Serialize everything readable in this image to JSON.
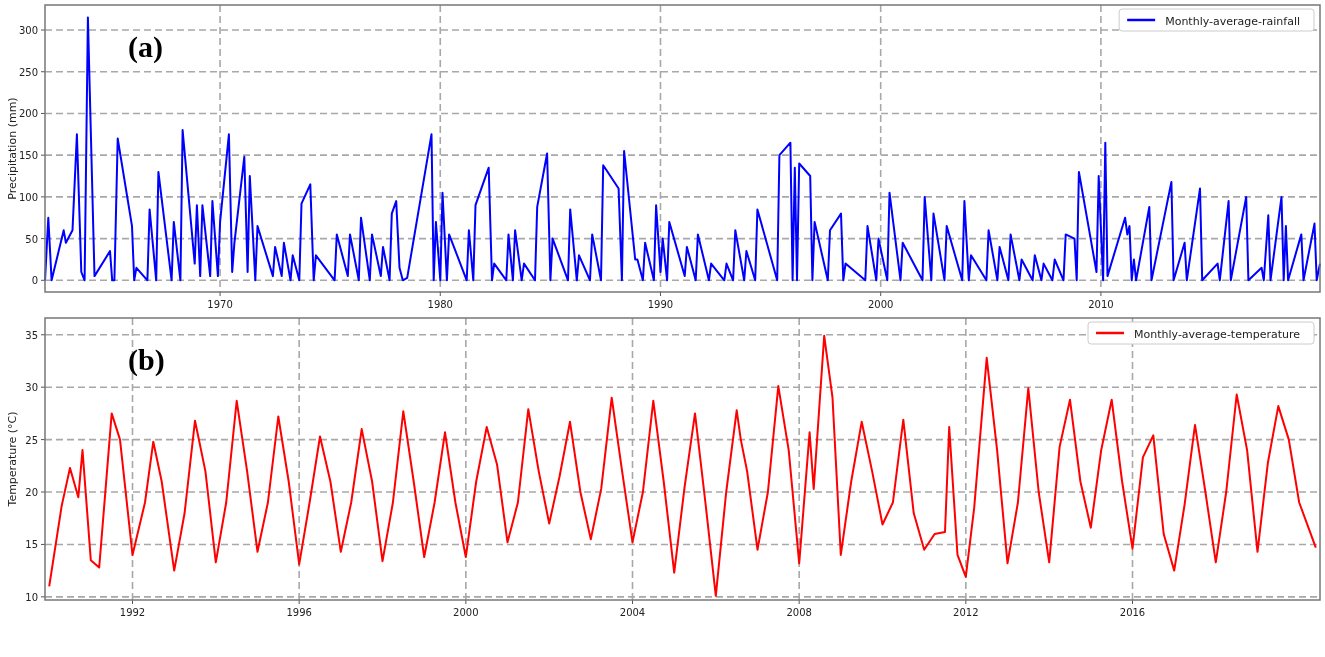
{
  "panels": [
    {
      "chart_data": {
        "type": "line",
        "ylabel": "Precipitation (mm)",
        "annotations": [
          "(a)"
        ],
        "grid": true,
        "xlim": [
          1962.05,
          2019.95
        ],
        "ylim": [
          -14,
          330
        ],
        "xticks": [
          {
            "value": 1970,
            "label": "1970"
          },
          {
            "value": 1980,
            "label": "1980"
          },
          {
            "value": 1990,
            "label": "1990"
          },
          {
            "value": 2000,
            "label": "2000"
          },
          {
            "value": 2010,
            "label": "2010"
          }
        ],
        "yticks": [
          {
            "value": 0,
            "label": "0"
          },
          {
            "value": 50,
            "label": "50"
          },
          {
            "value": 100,
            "label": "100"
          },
          {
            "value": 150,
            "label": "150"
          },
          {
            "value": 200,
            "label": "200"
          },
          {
            "value": 250,
            "label": "250"
          },
          {
            "value": 300,
            "label": "300"
          }
        ],
        "x": [
          1962.05,
          1962.2,
          1962.35,
          1962.9,
          1963.0,
          1963.3,
          1963.5,
          1963.7,
          1963.85,
          1964.0,
          1964.3,
          1965.0,
          1965.1,
          1965.2,
          1965.35,
          1966.0,
          1966.1,
          1966.2,
          1966.7,
          1966.8,
          1967.1,
          1967.2,
          1967.8,
          1967.9,
          1968.2,
          1968.3,
          1968.85,
          1968.95,
          1969.1,
          1969.2,
          1969.55,
          1969.65,
          1969.9,
          1970.0,
          1970.4,
          1970.55,
          1970.65,
          1971.1,
          1971.25,
          1971.35,
          1971.6,
          1971.7,
          1972.4,
          1972.5,
          1972.8,
          1972.9,
          1973.2,
          1973.3,
          1973.6,
          1973.7,
          1974.1,
          1974.25,
          1974.35,
          1975.2,
          1975.3,
          1975.8,
          1975.9,
          1976.3,
          1976.4,
          1976.8,
          1976.9,
          1977.3,
          1977.4,
          1977.7,
          1977.8,
          1978.0,
          1978.15,
          1978.3,
          1978.5,
          1979.6,
          1979.7,
          1979.8,
          1980.0,
          1980.1,
          1980.3,
          1980.4,
          1981.2,
          1981.3,
          1981.5,
          1981.6,
          1982.2,
          1982.35,
          1982.45,
          1983.0,
          1983.1,
          1983.3,
          1983.4,
          1983.7,
          1983.8,
          1984.3,
          1984.4,
          1984.85,
          1985.0,
          1985.1,
          1985.8,
          1985.9,
          1986.2,
          1986.3,
          1986.8,
          1986.9,
          1987.3,
          1987.4,
          1988.1,
          1988.25,
          1988.35,
          1988.85,
          1988.95,
          1989.2,
          1989.3,
          1989.7,
          1989.8,
          1990.0,
          1990.1,
          1990.3,
          1990.4,
          1991.1,
          1991.2,
          1991.6,
          1991.7,
          1992.2,
          1992.3,
          1992.9,
          1993.0,
          1993.3,
          1993.4,
          1993.8,
          1993.9,
          1994.3,
          1994.4,
          1995.3,
          1995.4,
          1995.9,
          1996.0,
          1996.1,
          1996.2,
          1996.3,
          1996.8,
          1996.9,
          1997.0,
          1997.6,
          1997.7,
          1998.2,
          1998.3,
          1998.4,
          1999.3,
          1999.4,
          1999.8,
          1999.9,
          2000.3,
          2000.4,
          2000.9,
          2001.0,
          2001.9,
          2002.0,
          2002.3,
          2002.4,
          2002.9,
          2003.0,
          2003.7,
          2003.8,
          2004.0,
          2004.1,
          2004.8,
          2004.9,
          2005.3,
          2005.4,
          2005.8,
          2005.9,
          2006.3,
          2006.4,
          2006.9,
          2007.0,
          2007.3,
          2007.4,
          2007.8,
          2007.9,
          2008.3,
          2008.4,
          2008.8,
          2008.9,
          2009.0,
          2009.8,
          2009.9,
          2010.1,
          2010.2,
          2010.3,
          2011.1,
          2011.2,
          2011.3,
          2011.4,
          2011.5,
          2011.6,
          2012.2,
          2012.3,
          2013.2,
          2013.3,
          2013.8,
          2013.9,
          2014.5,
          2014.6,
          2015.3,
          2015.4,
          2015.8,
          2015.9,
          2016.6,
          2016.7,
          2017.3,
          2017.4,
          2017.6,
          2017.7,
          2018.2,
          2018.3,
          2018.4,
          2018.5,
          2019.1,
          2019.2,
          2019.7,
          2019.8,
          2019.95
        ],
        "series": [
          {
            "name": "Monthly-average-rainfall",
            "color": "#0000ff",
            "values": [
              0,
              75,
              0,
              60,
              45,
              60,
              175,
              10,
              0,
              315,
              5,
              35,
              0,
              0,
              170,
              65,
              0,
              15,
              0,
              85,
              0,
              130,
              0,
              70,
              0,
              180,
              20,
              90,
              5,
              90,
              5,
              95,
              5,
              70,
              175,
              10,
              45,
              148,
              10,
              125,
              0,
              65,
              5,
              40,
              5,
              45,
              0,
              30,
              0,
              92,
              115,
              0,
              30,
              0,
              55,
              5,
              55,
              0,
              75,
              0,
              55,
              5,
              40,
              0,
              80,
              95,
              15,
              0,
              3,
              175,
              0,
              70,
              0,
              105,
              0,
              55,
              0,
              60,
              0,
              90,
              135,
              0,
              20,
              0,
              55,
              0,
              60,
              0,
              20,
              0,
              88,
              152,
              0,
              50,
              0,
              85,
              0,
              30,
              0,
              55,
              0,
              138,
              110,
              0,
              155,
              25,
              25,
              0,
              45,
              0,
              90,
              10,
              50,
              0,
              70,
              5,
              40,
              0,
              55,
              0,
              20,
              0,
              20,
              0,
              60,
              0,
              35,
              0,
              85,
              0,
              150,
              165,
              0,
              135,
              0,
              140,
              125,
              0,
              70,
              0,
              60,
              80,
              0,
              20,
              0,
              65,
              0,
              50,
              0,
              105,
              0,
              45,
              0,
              100,
              0,
              80,
              0,
              65,
              0,
              95,
              0,
              30,
              0,
              60,
              0,
              40,
              0,
              55,
              0,
              25,
              0,
              30,
              0,
              20,
              0,
              25,
              0,
              55,
              50,
              0,
              130,
              10,
              125,
              0,
              165,
              5,
              75,
              55,
              65,
              0,
              25,
              0,
              88,
              0,
              118,
              0,
              45,
              0,
              110,
              0,
              20,
              0,
              95,
              0,
              100,
              0,
              15,
              0,
              78,
              0,
              100,
              0,
              65,
              0,
              55,
              0,
              68,
              0,
              20
            ]
          }
        ]
      }
    },
    {
      "chart_data": {
        "type": "line",
        "ylabel": "Temperature (°C)",
        "annotations": [
          "(b)"
        ],
        "grid": true,
        "xlim": [
          1989.9,
          2020.5
        ],
        "ylim": [
          9.7,
          36.6
        ],
        "xticks": [
          {
            "value": 1992,
            "label": "1992"
          },
          {
            "value": 1996,
            "label": "1996"
          },
          {
            "value": 2000,
            "label": "2000"
          },
          {
            "value": 2004,
            "label": "2004"
          },
          {
            "value": 2008,
            "label": "2008"
          },
          {
            "value": 2012,
            "label": "2012"
          },
          {
            "value": 2016,
            "label": "2016"
          }
        ],
        "yticks": [
          {
            "value": 10,
            "label": "10"
          },
          {
            "value": 15,
            "label": "15"
          },
          {
            "value": 20,
            "label": "20"
          },
          {
            "value": 25,
            "label": "25"
          },
          {
            "value": 30,
            "label": "30"
          },
          {
            "value": 35,
            "label": "35"
          }
        ],
        "x": [
          1990.0,
          1990.3,
          1990.5,
          1990.7,
          1990.8,
          1991.0,
          1991.2,
          1991.5,
          1991.7,
          1992.0,
          1992.3,
          1992.5,
          1992.7,
          1993.0,
          1993.25,
          1993.5,
          1993.75,
          1994.0,
          1994.25,
          1994.5,
          1994.75,
          1995.0,
          1995.25,
          1995.5,
          1995.75,
          1996.0,
          1996.25,
          1996.5,
          1996.75,
          1997.0,
          1997.25,
          1997.5,
          1997.75,
          1998.0,
          1998.25,
          1998.5,
          1998.75,
          1999.0,
          1999.25,
          1999.5,
          1999.75,
          2000.0,
          2000.25,
          2000.5,
          2000.75,
          2001.0,
          2001.25,
          2001.5,
          2001.75,
          2002.0,
          2002.25,
          2002.5,
          2002.75,
          2003.0,
          2003.25,
          2003.5,
          2003.75,
          2004.0,
          2004.25,
          2004.5,
          2004.75,
          2005.0,
          2005.25,
          2005.5,
          2005.75,
          2006.0,
          2006.25,
          2006.5,
          2006.6,
          2006.75,
          2007.0,
          2007.25,
          2007.5,
          2007.75,
          2008.0,
          2008.25,
          2008.35,
          2008.6,
          2008.8,
          2009.0,
          2009.25,
          2009.5,
          2009.75,
          2010.0,
          2010.25,
          2010.5,
          2010.75,
          2011.0,
          2011.25,
          2011.5,
          2011.6,
          2011.8,
          2012.0,
          2012.2,
          2012.5,
          2012.75,
          2013.0,
          2013.25,
          2013.5,
          2013.75,
          2014.0,
          2014.25,
          2014.5,
          2014.75,
          2015.0,
          2015.25,
          2015.5,
          2015.75,
          2016.0,
          2016.25,
          2016.5,
          2016.75,
          2017.0,
          2017.25,
          2017.5,
          2017.75,
          2018.0,
          2018.25,
          2018.5,
          2018.75,
          2019.0,
          2019.25,
          2019.5,
          2019.75,
          2020.0,
          2020.4
        ],
        "series": [
          {
            "name": "Monthly-average-temperature",
            "color": "#ff0000",
            "values": [
              11,
              18.7,
              22.3,
              19.5,
              24,
              13.5,
              12.8,
              27.5,
              25,
              14,
              19,
              24.8,
              21,
              12.5,
              18,
              26.8,
              22,
              13.3,
              19,
              28.7,
              22,
              14.3,
              19,
              27.2,
              21,
              13.1,
              19,
              25.3,
              21,
              14.3,
              19,
              26,
              21,
              13.4,
              19,
              27.7,
              21,
              13.8,
              19,
              25.7,
              19,
              13.8,
              21,
              26.2,
              22.6,
              15.2,
              19,
              27.9,
              22,
              17,
              21.5,
              26.7,
              20,
              15.5,
              20.3,
              29,
              22,
              15.2,
              20,
              28.7,
              21,
              12.3,
              20.5,
              27.5,
              19,
              10.1,
              20,
              27.8,
              25,
              22,
              14.5,
              20,
              30.1,
              24,
              13.2,
              25.7,
              20.3,
              34.9,
              29,
              14,
              21,
              26.7,
              22,
              16.9,
              19,
              26.9,
              18,
              14.5,
              16,
              16.2,
              26.2,
              14,
              11.9,
              18.5,
              32.8,
              24,
              13.2,
              19,
              29.9,
              20,
              13.3,
              24.3,
              28.8,
              21,
              16.6,
              24,
              28.8,
              21,
              14.6,
              23.3,
              25.4,
              16,
              12.5,
              18.8,
              26.4,
              20,
              13.3,
              20,
              29.3,
              24,
              14.3,
              22.8,
              28.2,
              25,
              19,
              14.7
            ]
          }
        ]
      }
    }
  ]
}
